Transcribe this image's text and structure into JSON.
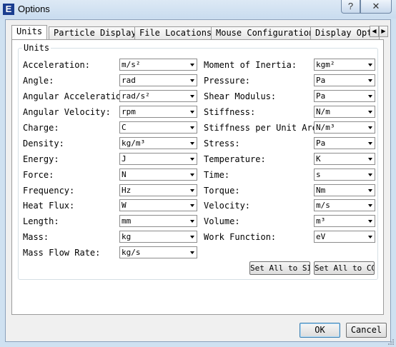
{
  "window": {
    "title": "Options",
    "app_icon": "E"
  },
  "tabs": [
    "Units",
    "Particle Display",
    "File Locations",
    "Mouse Configuration",
    "Display Opti"
  ],
  "group_title": "Units",
  "left_units": [
    {
      "label": "Acceleration:",
      "value": "m/s²"
    },
    {
      "label": "Angle:",
      "value": "rad"
    },
    {
      "label": "Angular Acceleration:",
      "value": "rad/s²"
    },
    {
      "label": "Angular Velocity:",
      "value": "rpm"
    },
    {
      "label": "Charge:",
      "value": "C"
    },
    {
      "label": "Density:",
      "value": "kg/m³"
    },
    {
      "label": "Energy:",
      "value": "J"
    },
    {
      "label": "Force:",
      "value": "N"
    },
    {
      "label": "Frequency:",
      "value": "Hz"
    },
    {
      "label": "Heat Flux:",
      "value": "W"
    },
    {
      "label": "Length:",
      "value": "mm"
    },
    {
      "label": "Mass:",
      "value": "kg"
    },
    {
      "label": "Mass Flow Rate:",
      "value": "kg/s"
    }
  ],
  "right_units": [
    {
      "label": "Moment of Inertia:",
      "value": "kgm²"
    },
    {
      "label": "Pressure:",
      "value": "Pa"
    },
    {
      "label": "Shear Modulus:",
      "value": "Pa"
    },
    {
      "label": "Stiffness:",
      "value": "N/m"
    },
    {
      "label": "Stiffness per Unit Area:",
      "value": "N/m³"
    },
    {
      "label": "Stress:",
      "value": "Pa"
    },
    {
      "label": "Temperature:",
      "value": "K"
    },
    {
      "label": "Time:",
      "value": "s"
    },
    {
      "label": "Torque:",
      "value": "Nm"
    },
    {
      "label": "Velocity:",
      "value": "m/s"
    },
    {
      "label": "Volume:",
      "value": "m³"
    },
    {
      "label": "Work Function:",
      "value": "eV"
    }
  ],
  "buttons": {
    "set_si": "Set All to SI",
    "set_cgs": "Set All to CGS",
    "ok": "OK",
    "cancel": "Cancel"
  }
}
